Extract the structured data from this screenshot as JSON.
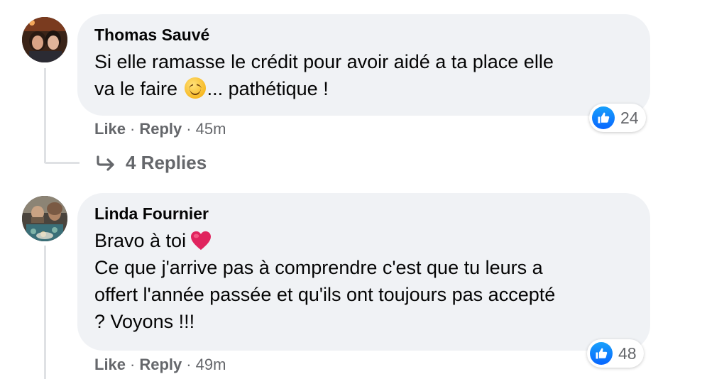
{
  "comments": [
    {
      "author": "Thomas Sauvé",
      "lines": [
        "Si elle ramasse le crédit pour avoir aidé a ta place elle",
        "va le faire",
        "... pathétique !"
      ],
      "reaction_count": "24",
      "actions": {
        "like": "Like",
        "reply": "Reply",
        "time": "45m"
      },
      "replies_label": "4 Replies"
    },
    {
      "author": "Linda Fournier",
      "lines": [
        "Bravo à toi",
        "Ce que j'arrive pas à comprendre c'est que tu leurs a",
        "offert l'année passée et qu'ils ont toujours pas accepté",
        "? Voyons !!!"
      ],
      "reaction_count": "48",
      "actions": {
        "like": "Like",
        "reply": "Reply",
        "time": "49m"
      }
    }
  ],
  "icons": {
    "like_badge": "thumbs-up-icon",
    "reply_arrow": "reply-arrow-icon",
    "smile_emoji": "smiling-face-emoji",
    "heart_emoji": "red-heart-emoji"
  },
  "colors": {
    "bubble": "#f0f2f5",
    "secondary_text": "#65676b",
    "like_blue": "#0866ff",
    "heart_red": "#e0245e"
  }
}
